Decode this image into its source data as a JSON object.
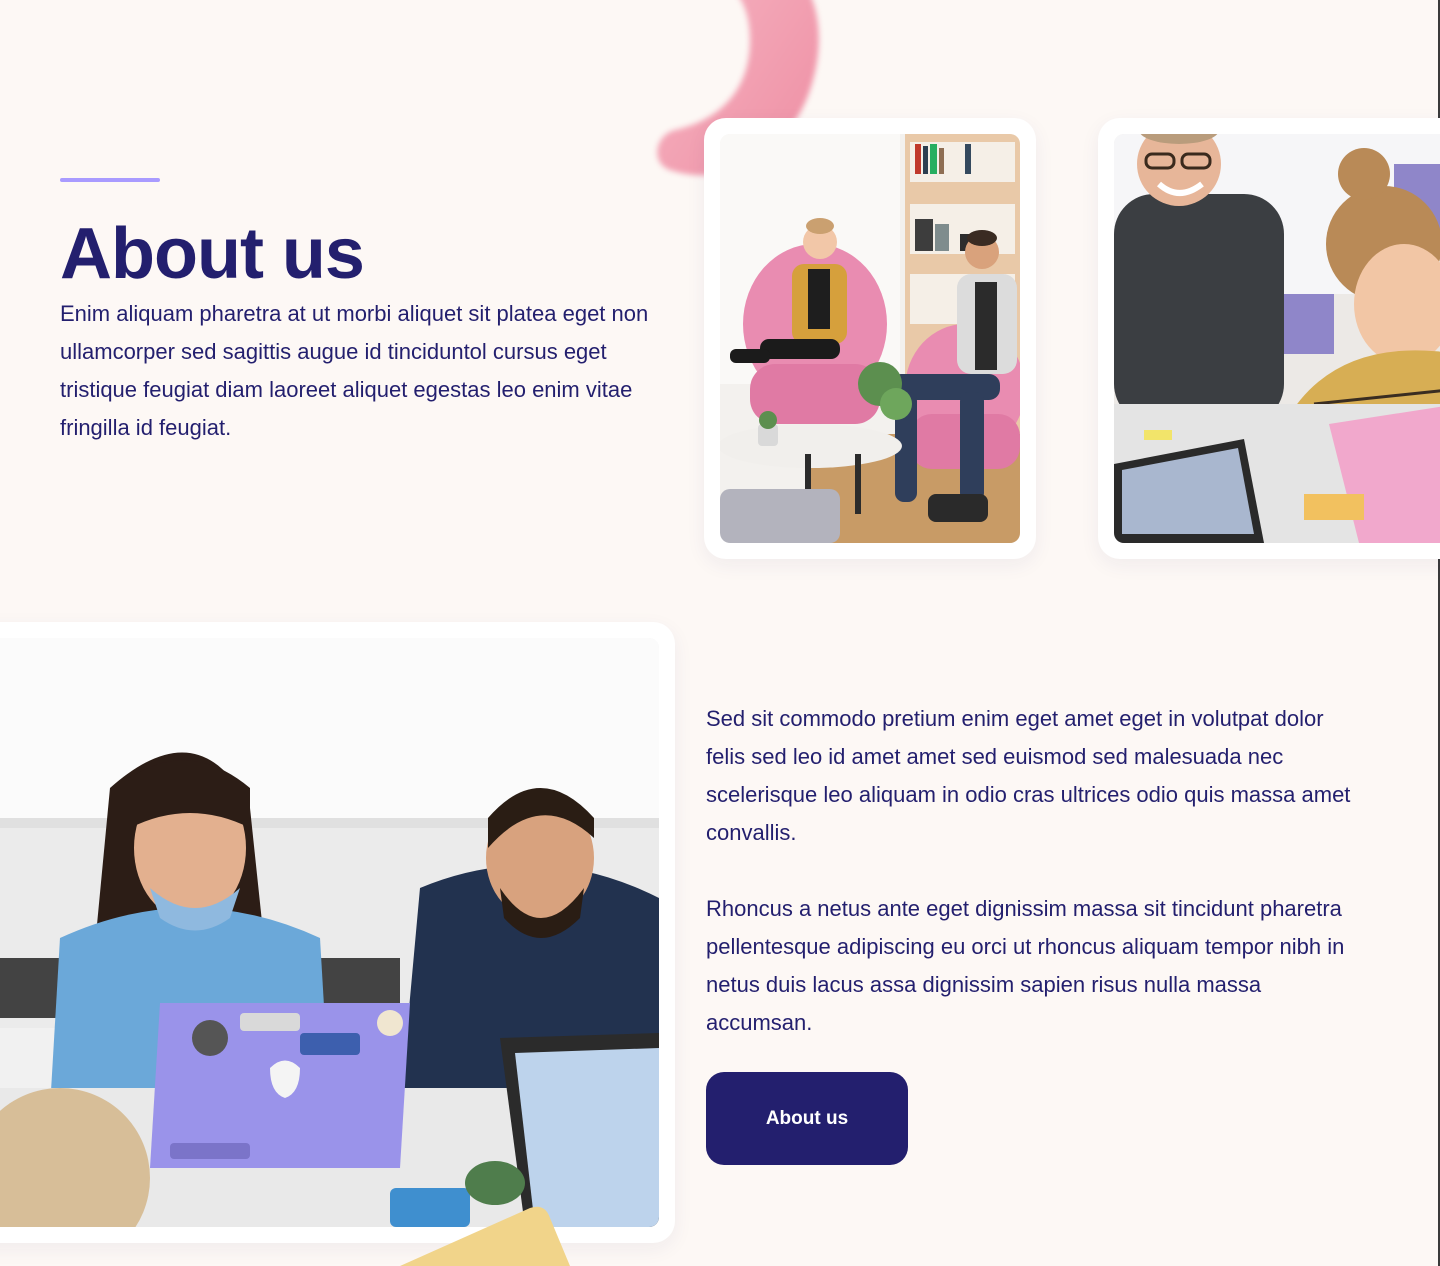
{
  "about": {
    "title": "About us",
    "intro": "Enim aliquam pharetra at ut morbi aliquet sit platea eget non ullamcorper sed sagittis augue id tinciduntol cursus eget tristique feugiat diam laoreet aliquet egestas leo enim vitae fringilla id feugiat."
  },
  "details": {
    "paragraph_1": "Sed sit commodo pretium enim eget amet eget in volutpat dolor felis sed leo id amet amet sed euismod sed malesuada nec scelerisque leo aliquam in odio cras ultrices odio quis massa amet convallis.",
    "paragraph_2": "Rhoncus a netus ante eget dignissim massa sit tincidunt pharetra pellentesque adipiscing eu orci ut rhoncus aliquam tempor nibh in netus duis lacus assa dignissim sapien risus nulla massa accumsan.",
    "button_label": "About us"
  },
  "colors": {
    "background": "#fdf8f5",
    "heading": "#231f6e",
    "accent_line": "#a99bff",
    "button": "#231f6e",
    "blob": "#f4a3b4",
    "card": "#ffffff"
  }
}
